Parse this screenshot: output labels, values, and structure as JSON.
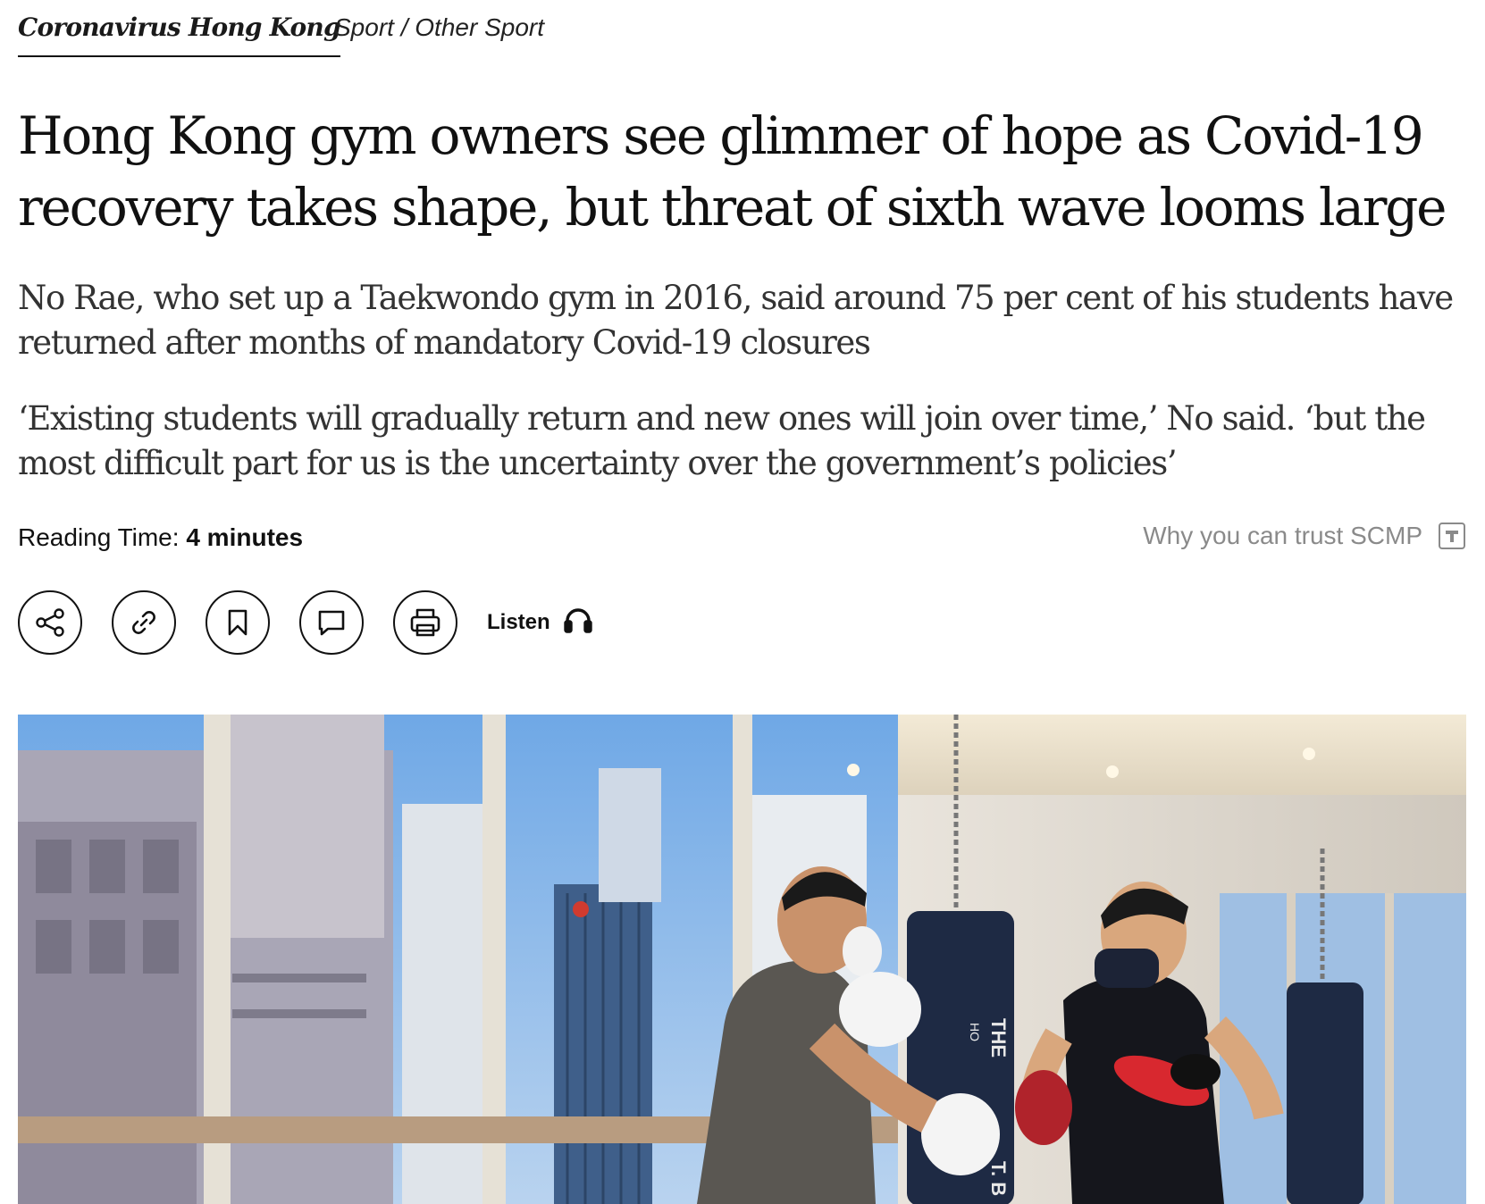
{
  "topic": {
    "label": "Coronavirus Hong Kong"
  },
  "section": {
    "label": "Sport / Other Sport"
  },
  "article": {
    "headline": "Hong Kong gym owners see glimmer of hope as Covid-19 recovery takes shape, but threat of sixth wave looms large",
    "summary_1": "No Rae, who set up a Taekwondo gym in 2016, said around 75 per cent of his students have returned after months of mandatory Covid-19 closures",
    "summary_2": "‘Existing students will gradually return and new ones will join over time,’ No said. ‘but the most difficult part for us is the uncertainty over the government’s policies’"
  },
  "meta": {
    "reading_time_label": "Reading Time:",
    "reading_time_value": "4 minutes",
    "trust_label": "Why you can trust SCMP"
  },
  "toolbar": {
    "buttons": [
      {
        "icon": "share-icon"
      },
      {
        "icon": "link-icon"
      },
      {
        "icon": "bookmark-icon"
      },
      {
        "icon": "comment-icon"
      },
      {
        "icon": "print-icon"
      }
    ],
    "listen_label": "Listen",
    "listen_icon": "headphones-icon"
  },
  "hero_image": {
    "signage_1": "THE",
    "signage_2": "HO",
    "signage_3": "T. B"
  }
}
